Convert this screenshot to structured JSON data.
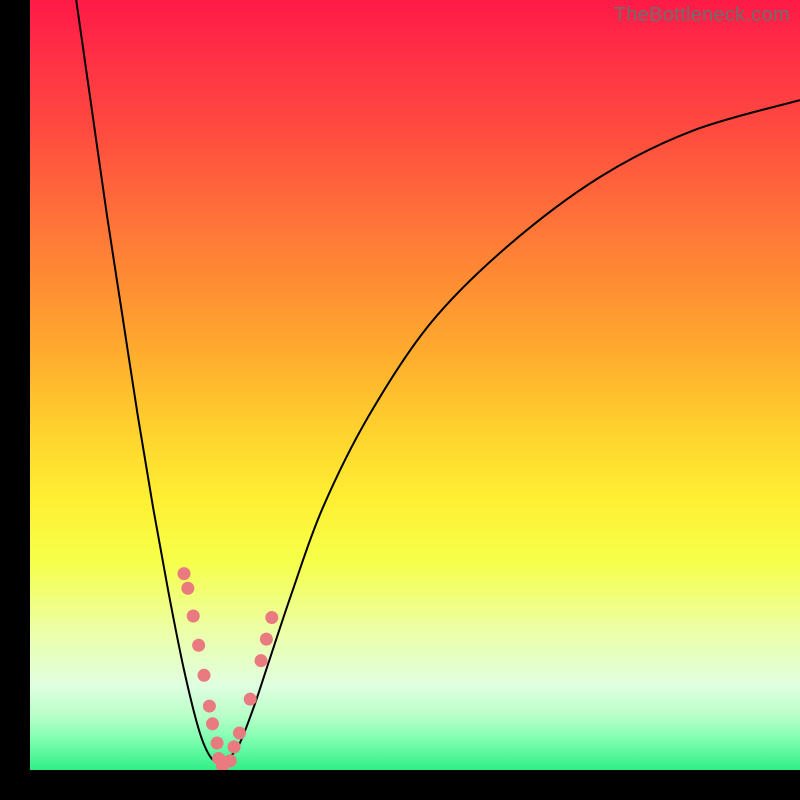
{
  "watermark": "TheBottleneck.com",
  "chart_data": {
    "type": "line",
    "title": "",
    "xlabel": "",
    "ylabel": "",
    "xlim": [
      0,
      100
    ],
    "ylim": [
      0,
      100
    ],
    "grid": false,
    "series": [
      {
        "name": "left-curve",
        "x": [
          6,
          8,
          10,
          12,
          14,
          16,
          18,
          20,
          22,
          23.5,
          25
        ],
        "y": [
          100,
          86,
          72,
          59,
          46,
          34,
          23,
          13,
          5,
          1.6,
          0.8
        ]
      },
      {
        "name": "right-curve",
        "x": [
          25,
          27,
          29,
          31,
          34,
          38,
          44,
          52,
          62,
          74,
          86,
          100
        ],
        "y": [
          0.8,
          3,
          8,
          14,
          23,
          34,
          46,
          58,
          68,
          77,
          83,
          87
        ]
      }
    ],
    "markers": [
      {
        "name": "pink-dots-left",
        "x": [
          20.0,
          20.5,
          21.2,
          21.9,
          22.6,
          23.3,
          23.7,
          24.3
        ],
        "y": [
          25.5,
          23.6,
          20.0,
          16.2,
          12.3,
          8.3,
          6.0,
          3.5
        ]
      },
      {
        "name": "pink-dots-right",
        "x": [
          26.5,
          27.2,
          28.6,
          30.0,
          30.7,
          31.4
        ],
        "y": [
          3.0,
          4.8,
          9.2,
          14.2,
          17.0,
          19.8
        ]
      },
      {
        "name": "pink-dots-bottom",
        "x": [
          24.5,
          25.2,
          25.0,
          26.0
        ],
        "y": [
          1.5,
          1.0,
          0.5,
          1.2
        ]
      }
    ],
    "colors": {
      "curve": "#000000",
      "marker": "#e87a80",
      "gradient_top": "#ff1a47",
      "gradient_bottom": "#30ef87"
    }
  }
}
